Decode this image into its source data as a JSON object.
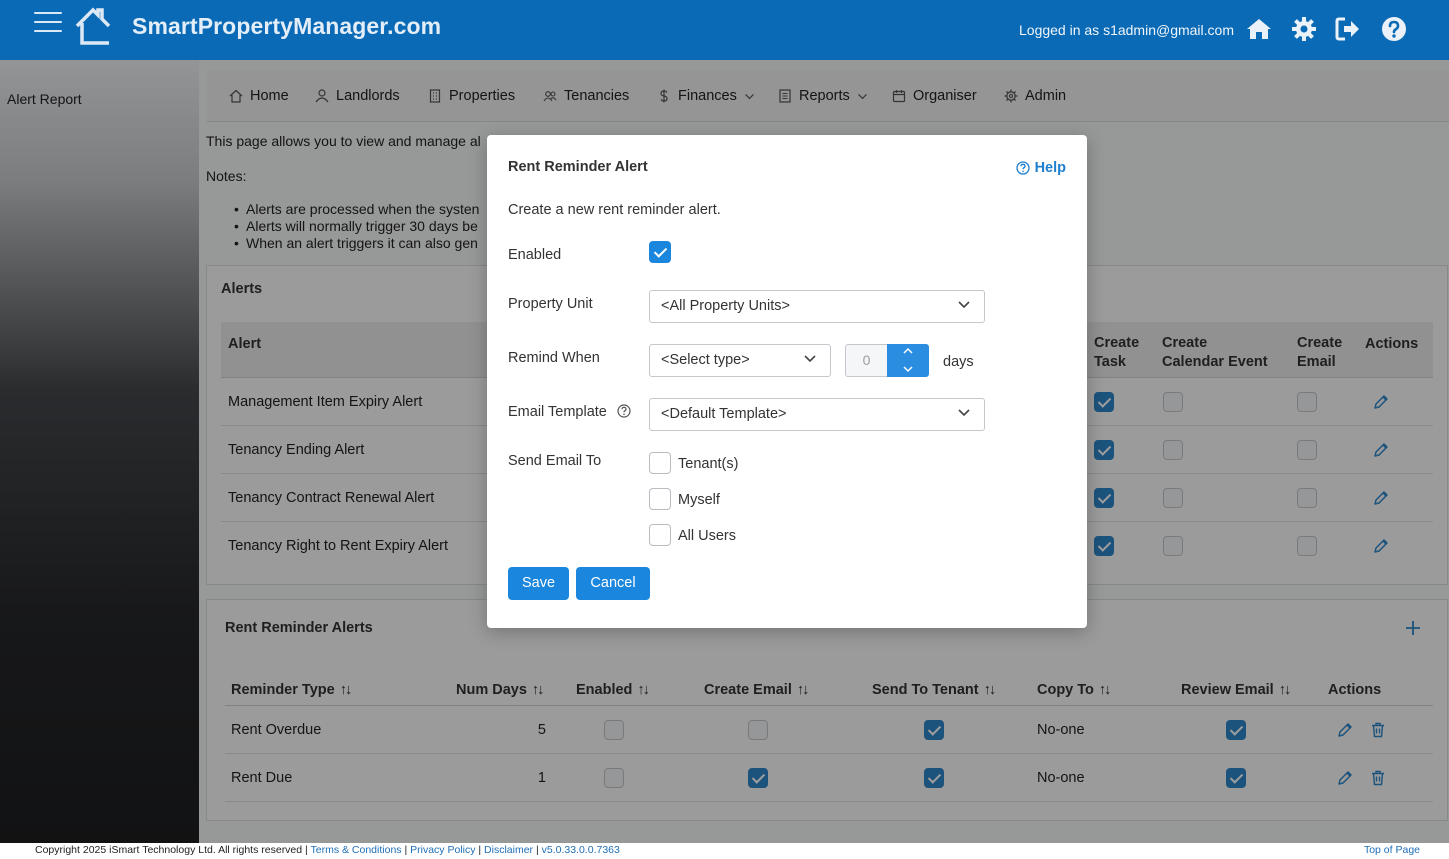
{
  "header": {
    "brand": "SmartPropertyManager.com",
    "login_text": "Logged in as s1admin@gmail.com",
    "icons": [
      "home-icon",
      "gear-icon",
      "logout-icon",
      "help-icon"
    ]
  },
  "sidebar": {
    "items": [
      {
        "label": "Alert Report"
      }
    ]
  },
  "nav": {
    "items": [
      {
        "label": "Home",
        "icon": "home-icon"
      },
      {
        "label": "Landlords",
        "icon": "user-icon"
      },
      {
        "label": "Properties",
        "icon": "building-icon"
      },
      {
        "label": "Tenancies",
        "icon": "users-icon"
      },
      {
        "label": "Finances",
        "icon": "dollar-icon"
      },
      {
        "label": "Reports",
        "icon": "report-icon"
      },
      {
        "label": "Organiser",
        "icon": "calendar-icon"
      },
      {
        "label": "Admin",
        "icon": "gear-icon"
      }
    ]
  },
  "page": {
    "intro": "This page allows you to view and manage al",
    "notes_label": "Notes:",
    "notes": [
      "Alerts are processed when the systen",
      "Alerts will normally trigger 30 days be",
      "When an alert triggers it can also gen"
    ]
  },
  "alerts": {
    "title": "Alerts",
    "columns": {
      "alert": "Alert",
      "create_task": "Create Task",
      "create_calendar_event": "Create Calendar Event",
      "create_email": "Create Email",
      "actions": "Actions"
    },
    "rows": [
      {
        "name": "Management Item Expiry Alert",
        "create_task": true,
        "create_calendar_event": false,
        "create_email": false
      },
      {
        "name": "Tenancy Ending Alert",
        "create_task": true,
        "create_calendar_event": false,
        "create_email": false
      },
      {
        "name": "Tenancy Contract Renewal Alert",
        "create_task": true,
        "create_calendar_event": false,
        "create_email": false
      },
      {
        "name": "Tenancy Right to Rent Expiry Alert",
        "create_task": true,
        "create_calendar_event": false,
        "create_email": false
      }
    ]
  },
  "rent_reminders": {
    "title": "Rent Reminder Alerts",
    "columns": {
      "reminder_type": "Reminder Type",
      "num_days": "Num Days",
      "enabled": "Enabled",
      "create_email": "Create Email",
      "send_to_tenant": "Send To Tenant",
      "copy_to": "Copy To",
      "review_email": "Review Email",
      "actions": "Actions"
    },
    "rows": [
      {
        "reminder_type": "Rent Overdue",
        "num_days": "5",
        "enabled": false,
        "create_email": false,
        "send_to_tenant": true,
        "copy_to": "No-one",
        "review_email": true
      },
      {
        "reminder_type": "Rent Due",
        "num_days": "1",
        "enabled": false,
        "create_email": true,
        "send_to_tenant": true,
        "copy_to": "No-one",
        "review_email": true
      }
    ]
  },
  "modal": {
    "title": "Rent Reminder Alert",
    "help_label": "Help",
    "description": "Create a new rent reminder alert.",
    "enabled_label": "Enabled",
    "enabled": true,
    "property_unit_label": "Property Unit",
    "property_unit_value": "<All Property Units>",
    "remind_when_label": "Remind When",
    "remind_when_value": "<Select type>",
    "days_value": "0",
    "days_label": "days",
    "email_template_label": "Email Template",
    "email_template_value": "<Default Template>",
    "send_email_to_label": "Send Email To",
    "recipients": [
      {
        "label": "Tenant(s)",
        "checked": false
      },
      {
        "label": "Myself",
        "checked": false
      },
      {
        "label": "All Users",
        "checked": false
      }
    ],
    "save_label": "Save",
    "cancel_label": "Cancel"
  },
  "footer": {
    "copyright": "Copyright 2025 iSmart Technology Ltd. All rights reserved | ",
    "terms": "Terms & Conditions",
    "privacy": "Privacy Policy",
    "disclaimer": "Disclaimer",
    "version": "v5.0.33.0.0.7363",
    "sep": " | ",
    "top_of_page": "Top of Page"
  },
  "colors": {
    "header": "#0a6ab6",
    "accent": "#1a86dd"
  }
}
